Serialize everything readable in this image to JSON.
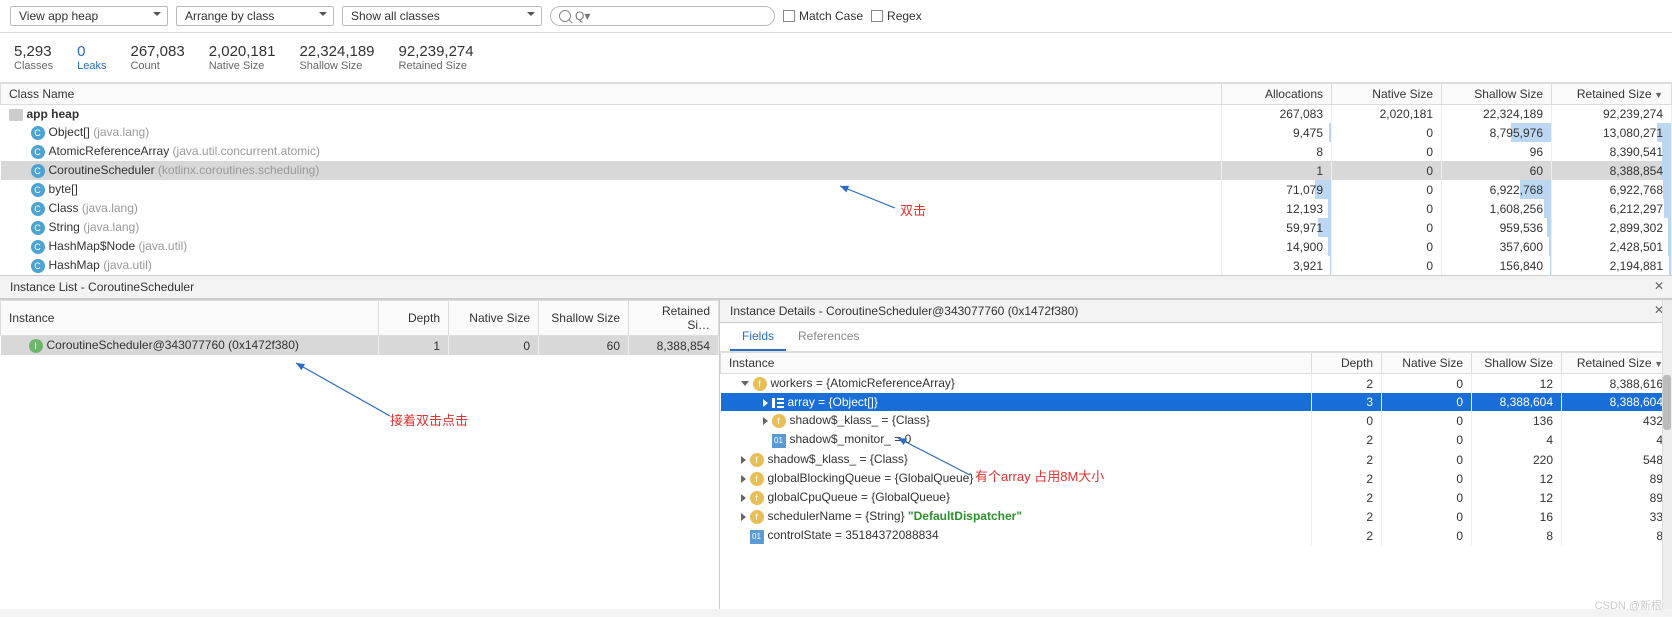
{
  "toolbar": {
    "heap_dropdown": "View app heap",
    "arrange_dropdown": "Arrange by class",
    "show_dropdown": "Show all classes",
    "search_placeholder": "Q▾",
    "match_case": "Match Case",
    "regex": "Regex"
  },
  "stats": {
    "classes": {
      "num": "5,293",
      "lbl": "Classes"
    },
    "leaks": {
      "num": "0",
      "lbl": "Leaks"
    },
    "count": {
      "num": "267,083",
      "lbl": "Count"
    },
    "native": {
      "num": "2,020,181",
      "lbl": "Native Size"
    },
    "shallow": {
      "num": "22,324,189",
      "lbl": "Shallow Size"
    },
    "retained": {
      "num": "92,239,274",
      "lbl": "Retained Size"
    }
  },
  "class_table": {
    "headers": {
      "name": "Class Name",
      "alloc": "Allocations",
      "native": "Native Size",
      "shallow": "Shallow Size",
      "retained": "Retained Size"
    },
    "root": {
      "name": "app heap",
      "alloc": "267,083",
      "native": "2,020,181",
      "shallow": "22,324,189",
      "retained": "92,239,274"
    },
    "rows": [
      {
        "name": "Object[]",
        "pkg": " (java.lang)",
        "alloc": "9,475",
        "native": "0",
        "shallow": "8,795,976",
        "retained": "13,080,271",
        "sw": 40,
        "rw": 14
      },
      {
        "name": "AtomicReferenceArray",
        "pkg": " (java.util.concurrent.atomic)",
        "alloc": "8",
        "native": "0",
        "shallow": "96",
        "retained": "8,390,541",
        "sw": 0,
        "rw": 9
      },
      {
        "name": "CoroutineScheduler",
        "pkg": " (kotlinx.coroutines.scheduling)",
        "alloc": "1",
        "native": "0",
        "shallow": "60",
        "retained": "8,388,854",
        "sel": true,
        "sw": 0,
        "rw": 9
      },
      {
        "name": "byte[]",
        "pkg": "",
        "alloc": "71,079",
        "native": "0",
        "shallow": "6,922,768",
        "retained": "6,922,768",
        "sw": 31,
        "rw": 8
      },
      {
        "name": "Class",
        "pkg": " (java.lang)",
        "alloc": "12,193",
        "native": "0",
        "shallow": "1,608,256",
        "retained": "6,212,297",
        "sw": 7,
        "rw": 7
      },
      {
        "name": "String",
        "pkg": " (java.lang)",
        "alloc": "59,971",
        "native": "0",
        "shallow": "959,536",
        "retained": "2,899,302",
        "sw": 4,
        "rw": 3
      },
      {
        "name": "HashMap$Node",
        "pkg": " (java.util)",
        "alloc": "14,900",
        "native": "0",
        "shallow": "357,600",
        "retained": "2,428,501",
        "sw": 2,
        "rw": 3
      },
      {
        "name": "HashMap",
        "pkg": " (java.util)",
        "alloc": "3,921",
        "native": "0",
        "shallow": "156,840",
        "retained": "2,194,881",
        "sw": 1,
        "rw": 2
      }
    ]
  },
  "instance_list": {
    "title": "Instance List - CoroutineScheduler",
    "headers": {
      "inst": "Instance",
      "depth": "Depth",
      "native": "Native Size",
      "shallow": "Shallow Size",
      "retained": "Retained Si…"
    },
    "rows": [
      {
        "name": "CoroutineScheduler@343077760 (0x1472f380)",
        "depth": "1",
        "native": "0",
        "shallow": "60",
        "retained": "8,388,854",
        "sel": true
      }
    ]
  },
  "instance_details": {
    "title": "Instance Details - CoroutineScheduler@343077760 (0x1472f380)",
    "tabs": {
      "fields": "Fields",
      "refs": "References"
    },
    "headers": {
      "inst": "Instance",
      "depth": "Depth",
      "native": "Native Size",
      "shallow": "Shallow Size",
      "retained": "Retained Size"
    },
    "rows": [
      {
        "indent": 0,
        "chev": "down",
        "icon": "f",
        "name": "workers = {AtomicReferenceArray}",
        "depth": "2",
        "native": "0",
        "shallow": "12",
        "retained": "8,388,616"
      },
      {
        "indent": 1,
        "chev": "right",
        "icon": "list",
        "name": "array = {Object[]}",
        "depth": "3",
        "native": "0",
        "shallow": "8,388,604",
        "retained": "8,388,604",
        "blue": true
      },
      {
        "indent": 1,
        "chev": "right",
        "icon": "f",
        "name": "shadow$_klass_ = {Class}",
        "depth": "0",
        "native": "0",
        "shallow": "136",
        "retained": "432"
      },
      {
        "indent": 1,
        "chev": "",
        "icon": "01",
        "name": "shadow$_monitor_ = 0",
        "depth": "2",
        "native": "0",
        "shallow": "4",
        "retained": "4"
      },
      {
        "indent": 0,
        "chev": "right",
        "icon": "f",
        "name": "shadow$_klass_ = {Class}",
        "depth": "2",
        "native": "0",
        "shallow": "220",
        "retained": "548"
      },
      {
        "indent": 0,
        "chev": "right",
        "icon": "f",
        "name": "globalBlockingQueue = {GlobalQueue}",
        "depth": "2",
        "native": "0",
        "shallow": "12",
        "retained": "89"
      },
      {
        "indent": 0,
        "chev": "right",
        "icon": "f",
        "name": "globalCpuQueue = {GlobalQueue}",
        "depth": "2",
        "native": "0",
        "shallow": "12",
        "retained": "89"
      },
      {
        "indent": 0,
        "chev": "right",
        "icon": "f",
        "name": "schedulerName = {String} ",
        "green": "\"DefaultDispatcher\"",
        "depth": "2",
        "native": "0",
        "shallow": "16",
        "retained": "33"
      },
      {
        "indent": 0,
        "chev": "",
        "icon": "01",
        "name": "controlState = 35184372088834",
        "depth": "2",
        "native": "0",
        "shallow": "8",
        "retained": "8"
      }
    ]
  },
  "annotations": {
    "a1": "双击",
    "a2": "接着双击点击",
    "a3": "有个array 占用8M大小"
  },
  "watermark": "CSDN @新根"
}
